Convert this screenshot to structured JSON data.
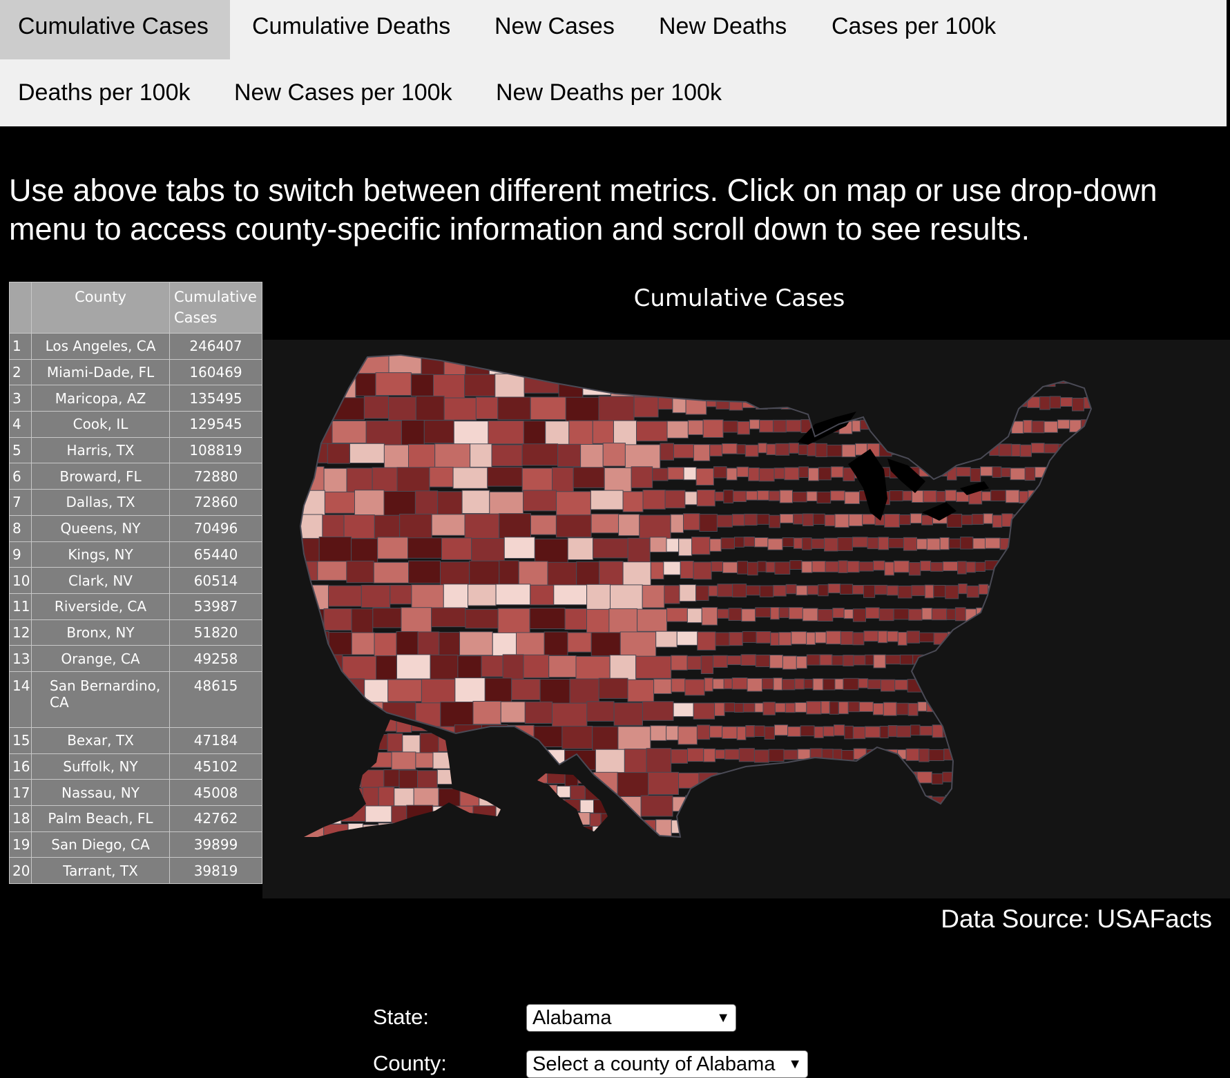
{
  "tabs": [
    {
      "label": "Cumulative Cases",
      "active": true
    },
    {
      "label": "Cumulative Deaths",
      "active": false
    },
    {
      "label": "New Cases",
      "active": false
    },
    {
      "label": "New Deaths",
      "active": false
    },
    {
      "label": "Cases per 100k",
      "active": false
    },
    {
      "label": "Deaths per 100k",
      "active": false
    },
    {
      "label": "New Cases per 100k",
      "active": false
    },
    {
      "label": "New Deaths per 100k",
      "active": false
    }
  ],
  "instructions": "Use above tabs to switch between different metrics. Click on map or use drop-down menu to access county-specific information and scroll down to see results.",
  "table": {
    "headers": {
      "county": "County",
      "value": "Cumulative Cases"
    },
    "rows": [
      {
        "rank": "1",
        "county": "Los Angeles, CA",
        "value": "246407"
      },
      {
        "rank": "2",
        "county": "Miami-Dade, FL",
        "value": "160469"
      },
      {
        "rank": "3",
        "county": "Maricopa, AZ",
        "value": "135495"
      },
      {
        "rank": "4",
        "county": "Cook, IL",
        "value": "129545"
      },
      {
        "rank": "5",
        "county": "Harris, TX",
        "value": "108819"
      },
      {
        "rank": "6",
        "county": "Broward, FL",
        "value": "72880"
      },
      {
        "rank": "7",
        "county": "Dallas, TX",
        "value": "72860"
      },
      {
        "rank": "8",
        "county": "Queens, NY",
        "value": "70496"
      },
      {
        "rank": "9",
        "county": "Kings, NY",
        "value": "65440"
      },
      {
        "rank": "10",
        "county": "Clark, NV",
        "value": "60514"
      },
      {
        "rank": "11",
        "county": "Riverside, CA",
        "value": "53987"
      },
      {
        "rank": "12",
        "county": "Bronx, NY",
        "value": "51820"
      },
      {
        "rank": "13",
        "county": "Orange, CA",
        "value": "49258"
      },
      {
        "rank": "14",
        "county": "San Bernardino, CA",
        "value": "48615"
      },
      {
        "rank": "15",
        "county": "Bexar, TX",
        "value": "47184"
      },
      {
        "rank": "16",
        "county": "Suffolk, NY",
        "value": "45102"
      },
      {
        "rank": "17",
        "county": "Nassau, NY",
        "value": "45008"
      },
      {
        "rank": "18",
        "county": "Palm Beach, FL",
        "value": "42762"
      },
      {
        "rank": "19",
        "county": "San Diego, CA",
        "value": "39899"
      },
      {
        "rank": "20",
        "county": "Tarrant, TX",
        "value": "39819"
      }
    ]
  },
  "map": {
    "title": "Cumulative Cases",
    "colors": {
      "panel": "#141414",
      "land": "#9a3b3b",
      "border": "#4a4a55",
      "water": "#000000"
    }
  },
  "source": "Data Source: USAFacts",
  "form": {
    "state_label": "State:",
    "state_value": "Alabama",
    "county_label": "County:",
    "county_value": "Select a county of Alabama"
  }
}
